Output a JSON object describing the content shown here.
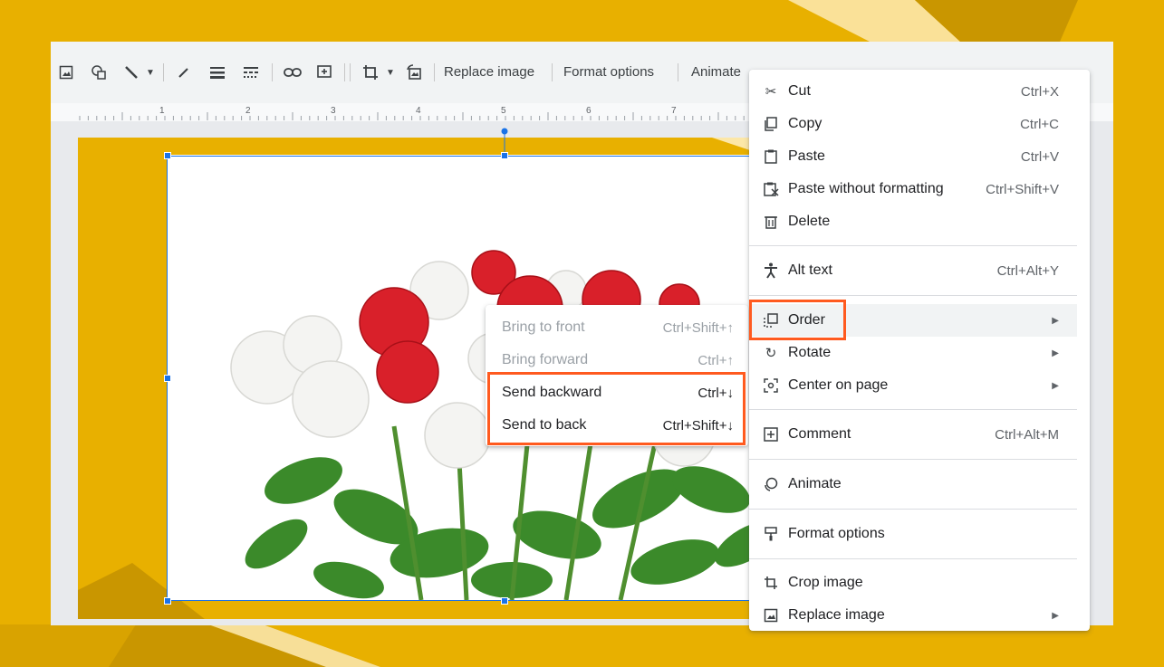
{
  "colors": {
    "background": "#e8b000",
    "highlight": "#ff5a1f",
    "selection": "#1a73e8"
  },
  "toolbar": {
    "icons": [
      "image-icon",
      "shapes-icon",
      "line-icon",
      "line-dropdown-icon",
      "pen-icon",
      "line-weight-icon",
      "line-dash-icon",
      "link-icon",
      "add-comment-icon",
      "crop-icon",
      "crop-dropdown-icon",
      "reset-image-icon"
    ],
    "replace_image": "Replace image",
    "format_options": "Format options",
    "animate": "Animate"
  },
  "ruler": {
    "numbers": [
      "1",
      "2",
      "3",
      "4",
      "5",
      "6",
      "7"
    ]
  },
  "context_menu": {
    "cut": {
      "label": "Cut",
      "shortcut": "Ctrl+X",
      "icon": "scissors-icon"
    },
    "copy": {
      "label": "Copy",
      "shortcut": "Ctrl+C",
      "icon": "copy-icon"
    },
    "paste": {
      "label": "Paste",
      "shortcut": "Ctrl+V",
      "icon": "clipboard-icon"
    },
    "paste_plain": {
      "label": "Paste without formatting",
      "shortcut": "Ctrl+Shift+V",
      "icon": "clipboard-plain-icon"
    },
    "delete": {
      "label": "Delete",
      "icon": "trash-icon"
    },
    "alt_text": {
      "label": "Alt text",
      "shortcut": "Ctrl+Alt+Y",
      "icon": "accessibility-icon"
    },
    "order": {
      "label": "Order",
      "icon": "order-icon"
    },
    "rotate": {
      "label": "Rotate",
      "icon": "rotate-icon"
    },
    "center": {
      "label": "Center on page",
      "icon": "center-icon"
    },
    "comment": {
      "label": "Comment",
      "shortcut": "Ctrl+Alt+M",
      "icon": "comment-icon"
    },
    "animate": {
      "label": "Animate",
      "icon": "animate-icon"
    },
    "format_options": {
      "label": "Format options",
      "icon": "paint-roller-icon"
    },
    "crop": {
      "label": "Crop image",
      "icon": "crop-icon"
    },
    "replace": {
      "label": "Replace image",
      "icon": "image-icon"
    }
  },
  "order_submenu": {
    "bring_front": {
      "label": "Bring to front",
      "shortcut": "Ctrl+Shift+↑",
      "enabled": false
    },
    "bring_forward": {
      "label": "Bring forward",
      "shortcut": "Ctrl+↑",
      "enabled": false
    },
    "send_backward": {
      "label": "Send backward",
      "shortcut": "Ctrl+↓",
      "enabled": true
    },
    "send_back": {
      "label": "Send to back",
      "shortcut": "Ctrl+Shift+↓",
      "enabled": true
    }
  }
}
